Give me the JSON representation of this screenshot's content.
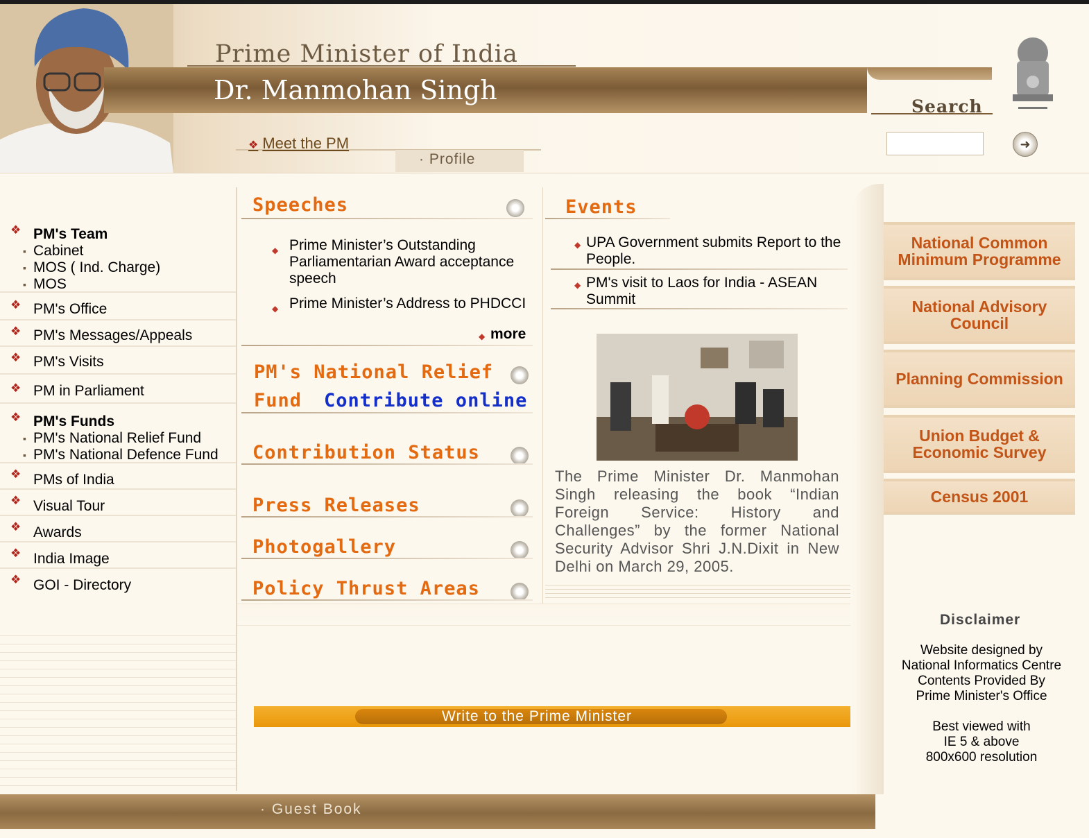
{
  "header": {
    "title_top": "Prime Minister of India",
    "title_name": "Dr. Manmohan Singh",
    "meet_link": "Meet the PM",
    "profile_link": "Profile"
  },
  "search": {
    "label": "Search",
    "value": "",
    "go_icon": "arrow-right-circle-icon"
  },
  "nav": {
    "team": {
      "label": "PM's Team",
      "sub": [
        "Cabinet",
        "MOS ( Ind. Charge)",
        "MOS"
      ]
    },
    "office": "PM's Office",
    "messages": "PM's Messages/Appeals",
    "visits": "PM's Visits",
    "parliament": "PM in Parliament",
    "funds": {
      "label": "PM's Funds",
      "sub": [
        "PM's National Relief Fund",
        "PM's National Defence Fund"
      ]
    },
    "pms": "PMs of India",
    "tour": "Visual Tour",
    "awards": "Awards",
    "image": "India Image",
    "goi": "GOI - Directory"
  },
  "speeches": {
    "heading": "Speeches",
    "items": [
      "Prime Minister’s Outstanding Parliamentarian Award acceptance speech",
      "Prime Minister’s Address to PHDCCI"
    ],
    "more": "more"
  },
  "relief": {
    "heading_line1": "PM's National Relief",
    "heading_fund": "Fund",
    "contribute": "Contribute online"
  },
  "sections": {
    "contribution_status": "Contribution Status",
    "press_releases": "Press Releases",
    "photogallery": "Photogallery",
    "policy": "Policy Thrust Areas"
  },
  "events": {
    "heading": "Events",
    "items": [
      "UPA Government submits Report to the People.",
      "PM's visit to Laos for India - ASEAN Summit"
    ],
    "caption": "The Prime Minister Dr. Manmohan Singh releasing the book “Indian Foreign Service: History and Challenges” by the former National Security Advisor Shri J.N.Dixit in New Delhi on March 29, 2005."
  },
  "write": {
    "label": "Write to the Prime Minister"
  },
  "right_links": [
    "National Common Minimum Programme",
    "National Advisory Council",
    "Planning Commission",
    "Union Budget & Economic Survey",
    "Census 2001"
  ],
  "disclaimer": {
    "heading": "Disclaimer",
    "lines": [
      "Website designed by",
      "National Informatics Centre",
      "Contents Provided By",
      "Prime Minister's Office"
    ],
    "best": [
      "Best viewed with",
      "IE 5 & above",
      "800x600 resolution"
    ]
  },
  "footer": {
    "guest_book": "Guest Book"
  },
  "colors": {
    "heading": "#e36a11",
    "link_blue": "#1430c8",
    "right_link": "#c25417",
    "band": "#7c5c37"
  }
}
